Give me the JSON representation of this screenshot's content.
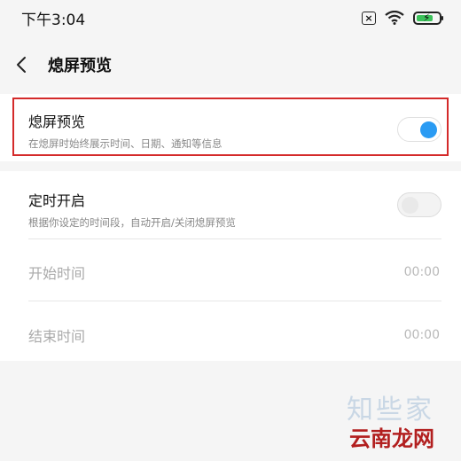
{
  "status_bar": {
    "time": "下午3:04",
    "icons": [
      "sim-x-icon",
      "wifi-icon",
      "battery-charging-icon"
    ]
  },
  "header": {
    "back_icon": "chevron-left-icon",
    "title": "熄屏预览"
  },
  "aod_setting": {
    "title": "熄屏预览",
    "subtitle": "在熄屏时始终展示时间、日期、通知等信息",
    "enabled": true
  },
  "schedule_setting": {
    "title": "定时开启",
    "subtitle": "根据你设定的时间段，自动开启/关闭熄屏预览",
    "enabled": false
  },
  "start_time": {
    "label": "开始时间",
    "value": "00:00"
  },
  "end_time": {
    "label": "结束时间",
    "value": "00:00"
  },
  "colors": {
    "accent": "#2a9bf3",
    "highlight_border": "#d42a2a",
    "battery": "#3cc15a"
  },
  "watermark": {
    "top": "知些家",
    "bottom": "云南龙网"
  }
}
